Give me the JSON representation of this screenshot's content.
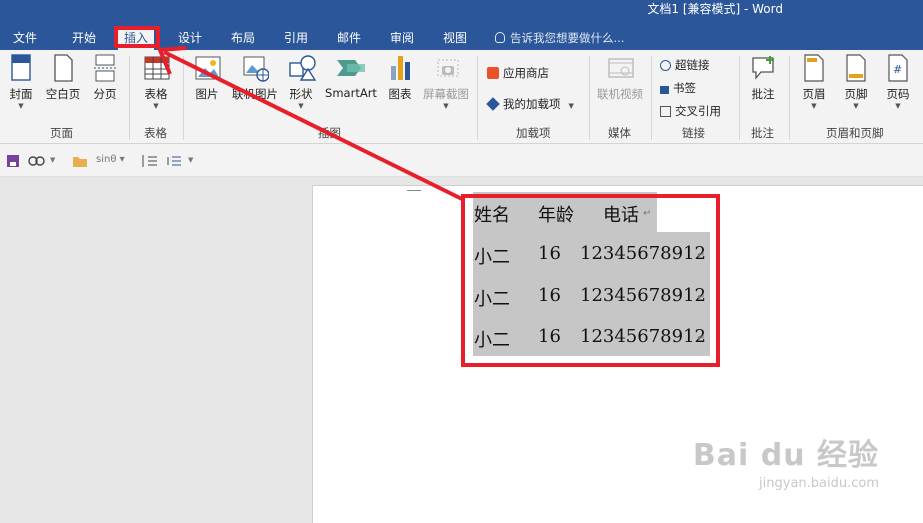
{
  "window": {
    "title": "文档1 [兼容模式] - Word"
  },
  "menu": {
    "tabs": [
      "文件",
      "开始",
      "插入",
      "设计",
      "布局",
      "引用",
      "邮件",
      "审阅",
      "视图"
    ],
    "active": "插入",
    "tellme": "告诉我您想要做什么..."
  },
  "ribbon": {
    "page_group": {
      "label": "页面",
      "cover": "封面",
      "blank": "空白页",
      "break": "分页"
    },
    "table_group": {
      "label": "表格",
      "table": "表格"
    },
    "illus_group": {
      "label": "插图",
      "picture": "图片",
      "online_picture": "联机图片",
      "shapes": "形状",
      "smartart": "SmartArt",
      "chart": "图表",
      "screenshot": "屏幕截图"
    },
    "addins_group": {
      "label": "加载项",
      "store": "应用商店",
      "my_addins": "我的加载项"
    },
    "media_group": {
      "label": "媒体",
      "online_video": "联机视频"
    },
    "links_group": {
      "label": "链接",
      "hyperlink": "超链接",
      "bookmark": "书签",
      "crossref": "交叉引用"
    },
    "comments_group": {
      "label": "批注",
      "comment": "批注"
    },
    "hf_group": {
      "label": "页眉和页脚",
      "header": "页眉",
      "footer": "页脚",
      "page_number": "页码"
    }
  },
  "qat": {
    "formula": "sinθ"
  },
  "document": {
    "table": {
      "headers": [
        "姓名",
        "年龄",
        "电话"
      ],
      "rows": [
        [
          "小二",
          "16",
          "12345678912"
        ],
        [
          "小二",
          "16",
          "12345678912"
        ],
        [
          "小二",
          "16",
          "12345678912"
        ]
      ]
    },
    "para_mark": "↵"
  },
  "watermark": {
    "line1": "Bai du 经验",
    "line2": "jingyan.baidu.com"
  },
  "colors": {
    "ribbon_blue": "#2b579a",
    "annotation_red": "#e81f2a",
    "selection_gray": "#c6c6c6"
  }
}
